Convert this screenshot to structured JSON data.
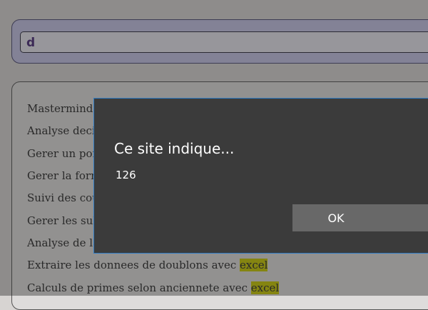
{
  "search": {
    "value": "d"
  },
  "results": [
    {
      "text": "Mastermind, ",
      "highlight": ""
    },
    {
      "text": "Analyse decis",
      "highlight": ""
    },
    {
      "text": "Gerer un port",
      "highlight": ""
    },
    {
      "text": "Gerer la form",
      "highlight": ""
    },
    {
      "text": "Suivi des cou",
      "highlight": ""
    },
    {
      "text": "Gerer les sub",
      "highlight": ""
    },
    {
      "text": "Analyse de la",
      "highlight": ""
    },
    {
      "text": "Extraire les donnees de doublons avec ",
      "highlight": "excel"
    },
    {
      "text": "Calculs de primes selon anciennete avec ",
      "highlight": "excel"
    }
  ],
  "dialog": {
    "title": "Ce site indique...",
    "message": "126",
    "ok_label": "OK"
  }
}
